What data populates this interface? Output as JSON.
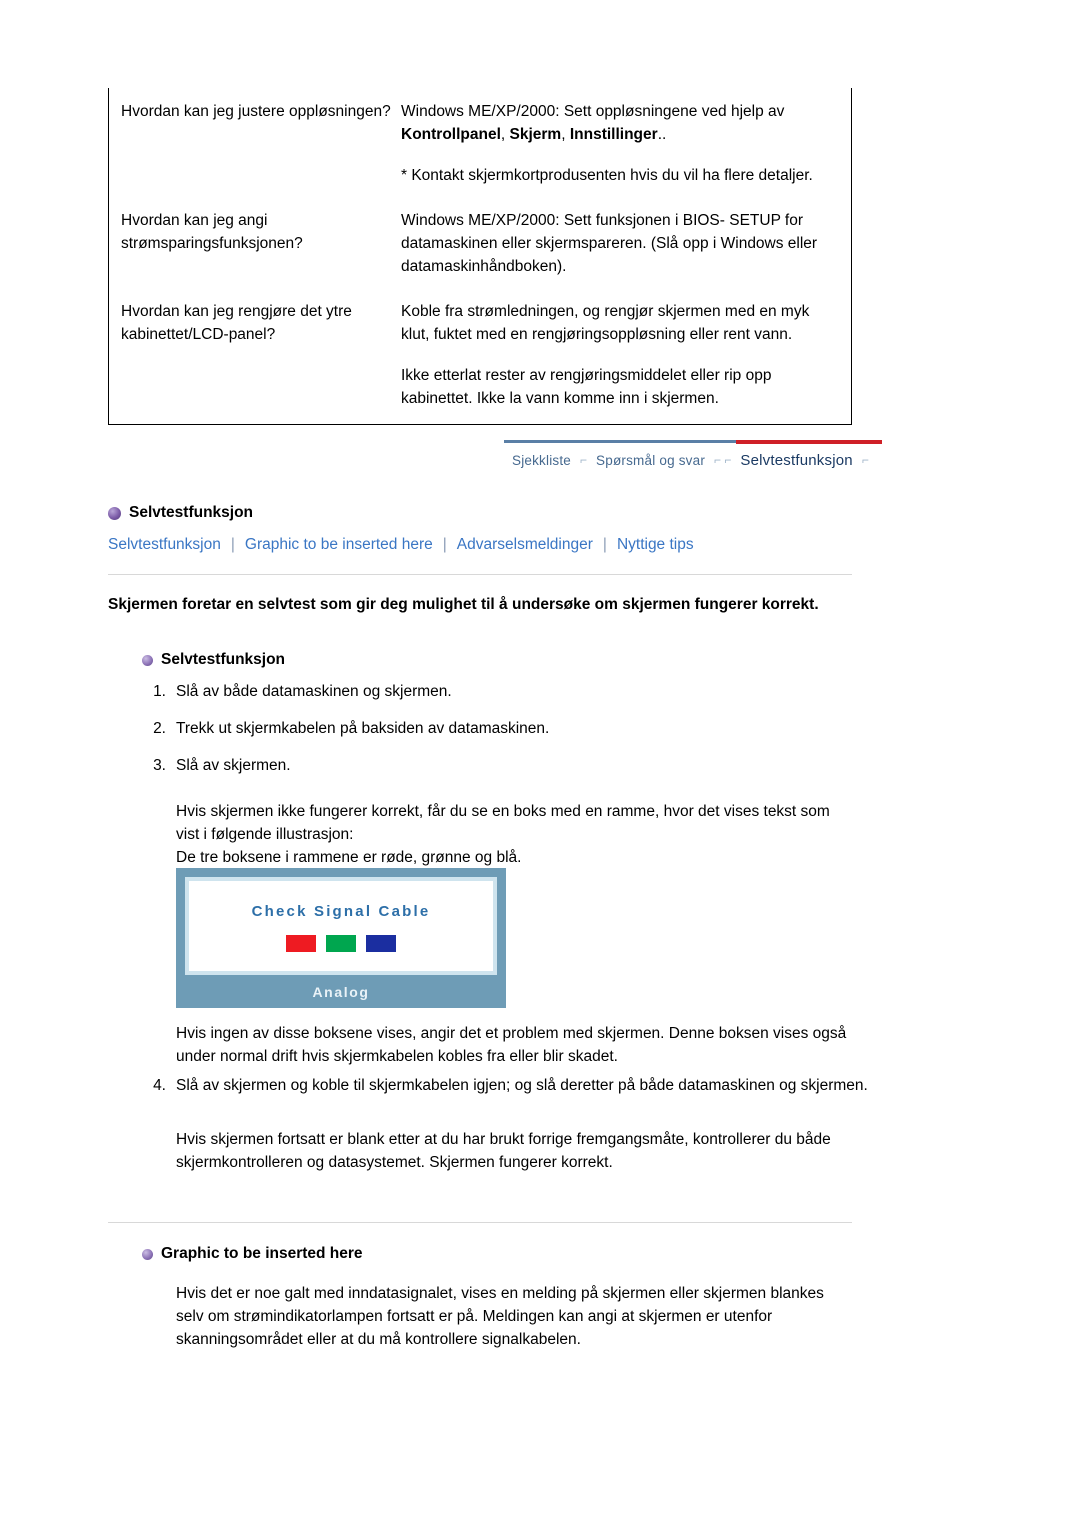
{
  "faq": {
    "rows": [
      {
        "question": "Hvordan kan jeg justere oppløsningen?",
        "answer_lines": [
          "Windows ME/XP/2000: Sett oppløsningene ved hjelp av",
          "Kontrollpanel, Skjerm, Innstillinger.."
        ],
        "answer_bold_segments": [
          "Kontrollpanel",
          "Skjerm",
          "Innstillinger"
        ],
        "note": "* Kontakt skjermkortprodusenten hvis du vil ha flere detaljer."
      },
      {
        "question": "Hvordan kan jeg angi strømsparingsfunksjonen?",
        "answer": "Windows ME/XP/2000: Sett funksjonen i BIOS- SETUP for datamaskinen eller skjermspareren. (Slå opp i Windows eller datamaskinhåndboken)."
      },
      {
        "question": "Hvordan kan jeg rengjøre det ytre kabinettet/LCD-panel?",
        "answer": "Koble fra strømledningen, og rengjør skjermen med en myk klut, fuktet med en rengjøringsoppløsning eller rent vann.",
        "note": "Ikke etterlat rester av rengjøringsmiddelet eller rip opp kabinettet. Ikke la vann komme inn i skjermen."
      }
    ]
  },
  "navbar": {
    "items": [
      {
        "label": "Sjekkliste",
        "active": false
      },
      {
        "label": "Spørsmål og svar",
        "active": false
      },
      {
        "label": "Selvtestfunksjon",
        "active": true
      }
    ],
    "line_left_color": "#5a7fa6",
    "line_right_color": "#cf2027"
  },
  "section": {
    "heading": "Selvtestfunksjon",
    "sublinks": [
      "Selvtestfunksjon",
      "Graphic to be inserted here",
      "Advarselsmeldinger",
      "Nyttige tips"
    ],
    "statement": "Skjermen foretar en selvtest som gir deg mulighet til å undersøke om skjermen fungerer korrekt.",
    "subheading": "Selvtestfunksjon",
    "steps": [
      {
        "num": "1.",
        "text": "Slå av både datamaskinen og skjermen."
      },
      {
        "num": "2.",
        "text": "Trekk ut skjermkabelen på baksiden av datamaskinen."
      },
      {
        "num": "3.",
        "text": "Slå av skjermen."
      }
    ],
    "after_step3": "Hvis skjermen ikke fungerer korrekt, får du se en boks med en ramme, hvor det vises tekst som vist i følgende illustrasjon:\nDe tre boksene i rammene er røde, grønne og blå.",
    "after_image": "Hvis ingen av disse boksene vises, angir det et problem med skjermen. Denne boksen vises også under normal drift hvis skjermkabelen kobles fra eller blir skadet.",
    "step4": {
      "num": "4.",
      "text": "Slå av skjermen og koble til skjermkabelen igjen; og slå deretter på både datamaskinen og skjermen."
    },
    "after_step4": "Hvis skjermen fortsatt er blank etter at du har brukt forrige fremgangsmåte, kontrollerer du både skjermkontrolleren og datasystemet. Skjermen fungerer korrekt.",
    "subheading2": "Graphic to be inserted here",
    "final_para": "Hvis det er noe galt med inndatasignalet, vises en melding på skjermen eller skjermen blankes selv om strømindikatorlampen fortsatt er på. Meldingen kan angi at skjermen er utenfor skanningsområdet eller at du må kontrollere signalkabelen."
  },
  "selftest_graphic": {
    "message": "Check Signal Cable",
    "mode_label": "Analog",
    "swatch_colors": [
      "#ee1b22",
      "#00a64f",
      "#1b2ea0"
    ],
    "frame_color": "#6e9cb6",
    "inner_border_color": "#cfe4ee",
    "text_color": "#2d6fa8"
  }
}
